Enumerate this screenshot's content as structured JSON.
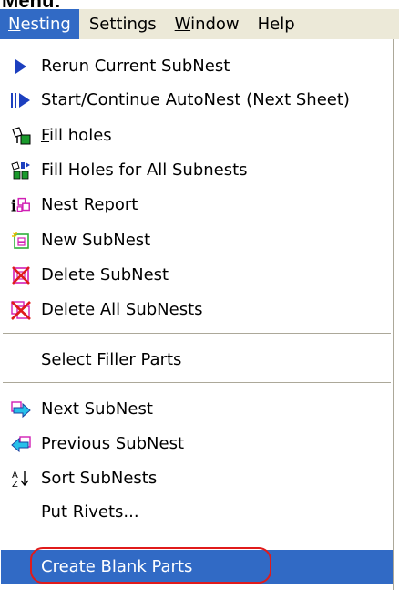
{
  "page_title": "Menu:",
  "menubar": {
    "items": [
      {
        "label": "Nesting",
        "mnemonic": "N",
        "rest": "esting"
      },
      {
        "label": "Settings"
      },
      {
        "label": "Window",
        "mnemonic": "W",
        "rest": "indow"
      },
      {
        "label": "Help"
      }
    ]
  },
  "menu": {
    "items": [
      {
        "label": "Rerun Current SubNest",
        "icon": "play-triangle-icon"
      },
      {
        "label": "Start/Continue AutoNest (Next Sheet)",
        "icon": "skip-play-icon"
      },
      {
        "label": "Fill holes",
        "icon": "fill-holes-icon",
        "mnemonic": "F",
        "rest": "ill holes"
      },
      {
        "label": "Fill Holes for All Subnests",
        "icon": "fill-holes-all-icon"
      },
      {
        "label": "Nest Report",
        "icon": "info-report-icon"
      },
      {
        "label": "New SubNest",
        "icon": "new-subnest-icon"
      },
      {
        "label": "Delete SubNest",
        "icon": "delete-subnest-icon"
      },
      {
        "label": "Delete All SubNests",
        "icon": "delete-all-subnests-icon"
      },
      {
        "label": "Select Filler Parts"
      },
      {
        "label": "Next SubNest",
        "icon": "next-arrow-icon"
      },
      {
        "label": "Previous SubNest",
        "icon": "previous-arrow-icon"
      },
      {
        "label": "Sort SubNests",
        "icon": "sort-az-icon"
      },
      {
        "label": "Put Rivets..."
      },
      {
        "label": "Create Blank Parts"
      }
    ]
  },
  "colors": {
    "menubar_bg": "#ece9d8",
    "highlight": "#316ac5",
    "annotation": "#e01b1b"
  }
}
